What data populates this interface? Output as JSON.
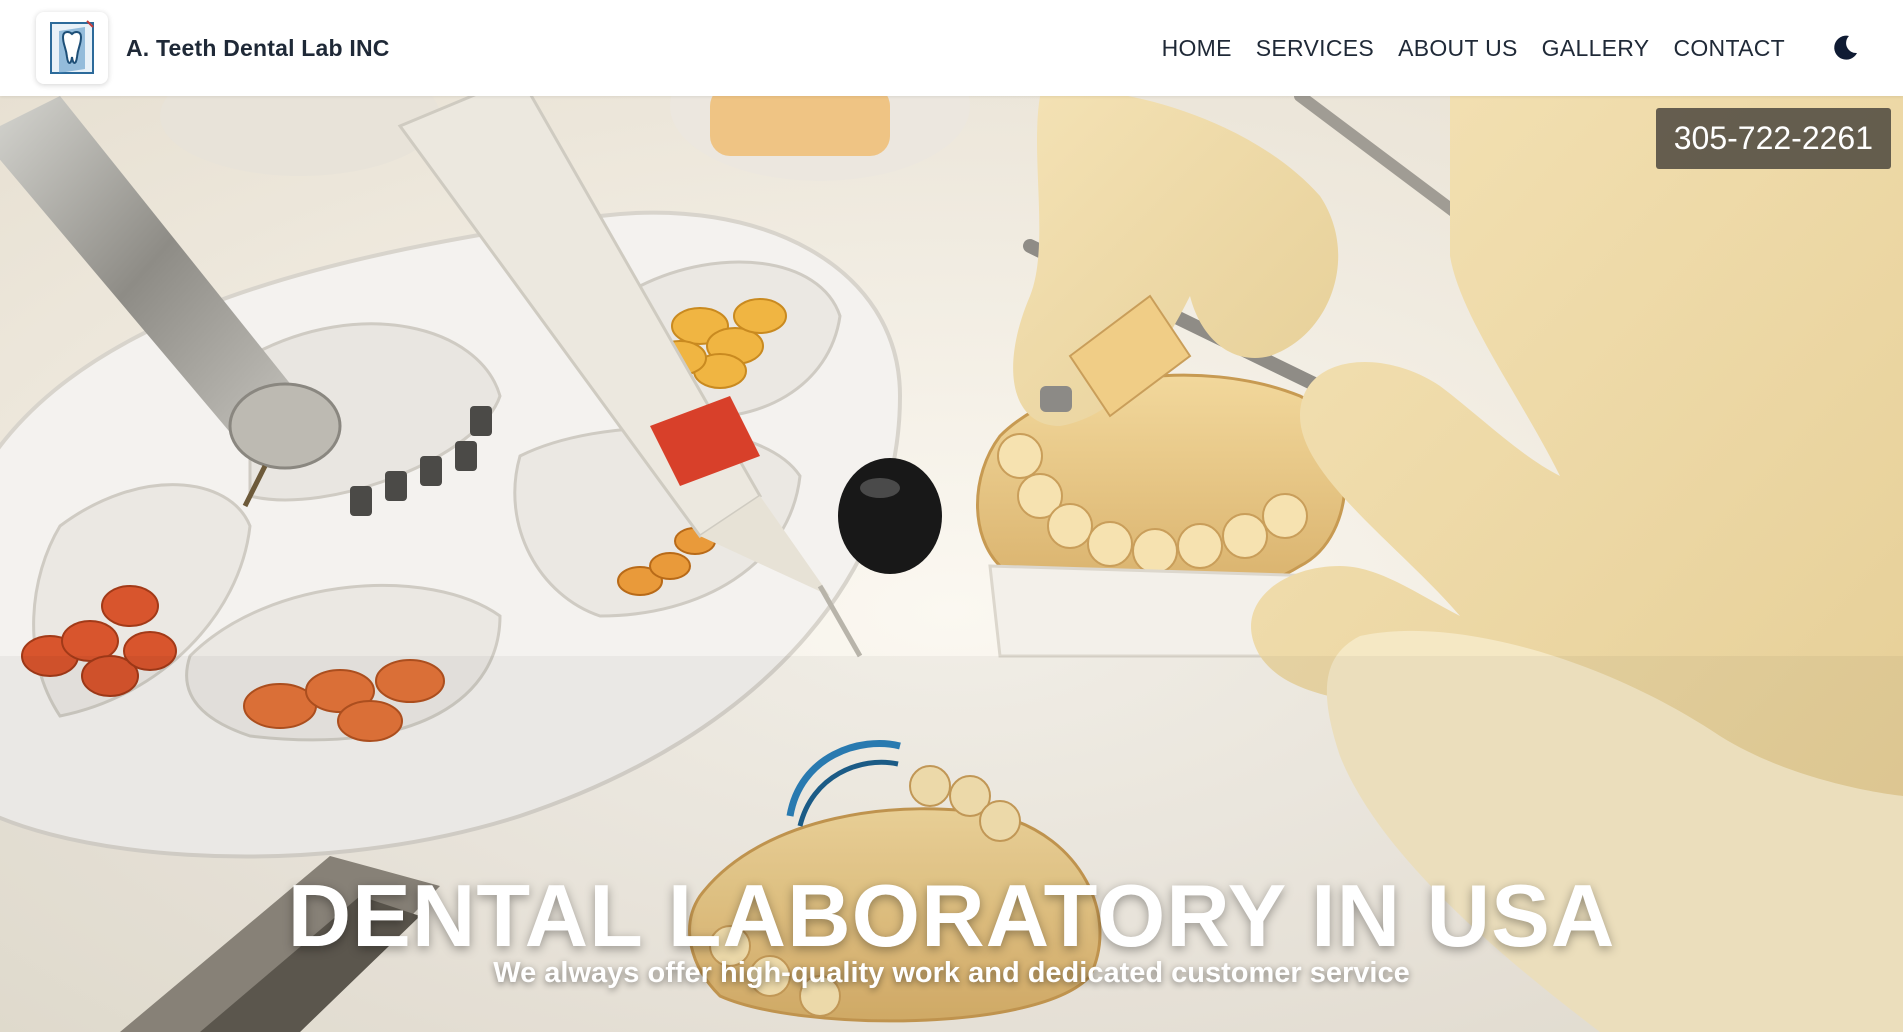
{
  "brand": {
    "name": "A. Teeth Dental Lab INC",
    "logo_icon": "tooth-logo-icon"
  },
  "nav": {
    "items": [
      {
        "label": "HOME"
      },
      {
        "label": "SERVICES"
      },
      {
        "label": "ABOUT US"
      },
      {
        "label": "GALLERY"
      },
      {
        "label": "CONTACT"
      }
    ],
    "theme_toggle_icon": "moon-icon"
  },
  "hero": {
    "phone": "305-722-2261",
    "title": "DENTAL LABORATORY IN USA",
    "subtitle": "We always offer high-quality work and dedicated customer service"
  },
  "colors": {
    "header_bg": "#ffffff",
    "text_dark": "#1f2937",
    "phone_badge_bg": "#3e3a34",
    "hero_text": "#ffffff"
  }
}
